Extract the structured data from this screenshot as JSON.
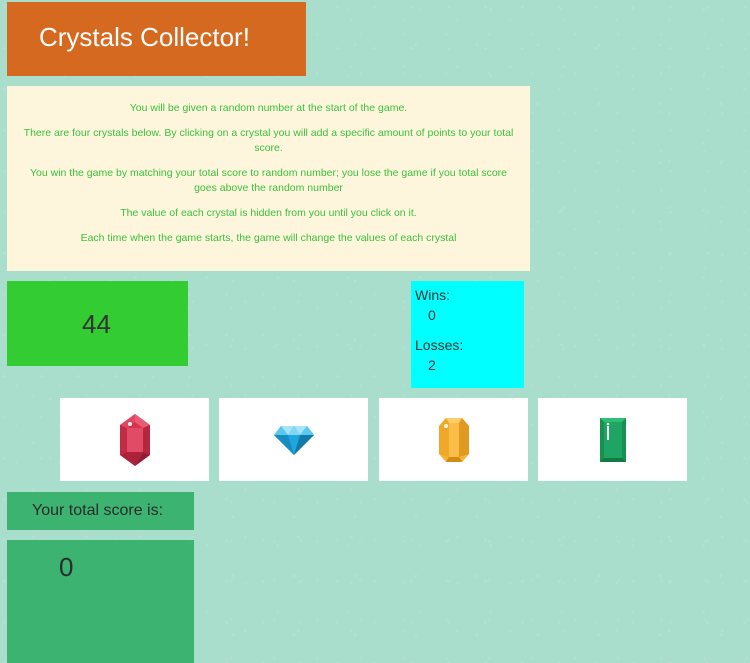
{
  "title": "Crystals Collector!",
  "instructions": [
    "You will be given a random number at the start of the game.",
    "There are four crystals below. By clicking on a crystal you will add a specific amount of points to your total score.",
    "You win the game by matching your total score to random number; you lose the game if you total score goes above the random number",
    "The value of each crystal is hidden from you until you click on it.",
    "Each time when the game starts, the game will change the values of each crystal"
  ],
  "target_number": "44",
  "stats": {
    "wins_label": "Wins:",
    "wins_value": "0",
    "losses_label": "Losses:",
    "losses_value": "2"
  },
  "crystals": [
    {
      "icon": "red-gem-icon",
      "color": "#d7324f"
    },
    {
      "icon": "blue-diamond-icon",
      "color": "#1fa6dd"
    },
    {
      "icon": "yellow-gem-icon",
      "color": "#f7b239"
    },
    {
      "icon": "green-gem-icon",
      "color": "#1fa463"
    }
  ],
  "score": {
    "label": "Your total score is:",
    "value": "0"
  },
  "colors": {
    "title_bg": "#d5691f",
    "instructions_bg": "#fdf6dd",
    "instructions_text": "#3cc13c",
    "target_bg": "#33cc33",
    "stats_bg": "#00ffff",
    "score_bg": "#3cb371",
    "page_bg": "#a9ddcc"
  }
}
